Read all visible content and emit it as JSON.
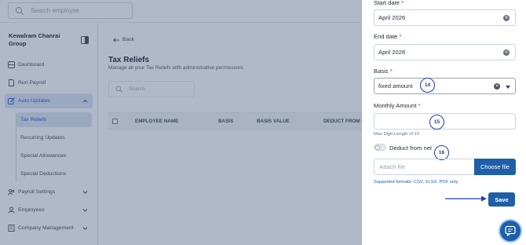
{
  "topbar": {
    "search_placeholder": "Search employee"
  },
  "sidebar": {
    "company_name": "Kewalram Chanrai Group",
    "items": [
      {
        "label": "Dashboard",
        "icon": "dashboard-icon"
      },
      {
        "label": "Run Payroll",
        "icon": "document-icon"
      },
      {
        "label": "Auto Updates",
        "icon": "edit-icon"
      },
      {
        "label": "Payroll Settings",
        "icon": "people-icon"
      },
      {
        "label": "Employees",
        "icon": "user-icon"
      },
      {
        "label": "Company Management",
        "icon": "building-icon"
      }
    ],
    "sub_items": [
      {
        "label": "Tax Reliefs"
      },
      {
        "label": "Recurring Updates"
      },
      {
        "label": "Special Allowances"
      },
      {
        "label": "Special Deductions"
      }
    ]
  },
  "main": {
    "back_label": "Back",
    "title": "Tax Reliefs",
    "subtitle": "Manage all your Tax Reliefs with administrative permissions.",
    "search_placeholder": "Search",
    "table_headers": [
      "EMPLOYEE NAME",
      "BASIS",
      "BASIS VALUE",
      "DEDUCT FROM N"
    ]
  },
  "panel": {
    "start_date_label": "Start date",
    "start_date_value": "April 2026",
    "end_date_label": "End date",
    "end_date_value": "April 2026",
    "basis_label": "Basis",
    "basis_value": "fixed amount",
    "monthly_amount_label": "Monthly Amount",
    "monthly_amount_value": "",
    "max_digit_hint": "Max Digit Length of 10",
    "deduct_label": "Deduct from net",
    "deduct_on": false,
    "attach_placeholder": "Attach file",
    "choose_file_label": "Choose file",
    "supported_formats": "Supported formats: CSV, XLSX, PDF only",
    "save_label": "Save",
    "required_mark": "*",
    "clear_glyph": "✕"
  },
  "annotations": [
    "14",
    "15",
    "16"
  ],
  "colors": {
    "primary": "#1e5fa8",
    "overlay": "#43587a",
    "required": "#dc2626",
    "active_bg": "#dbe4f3"
  }
}
